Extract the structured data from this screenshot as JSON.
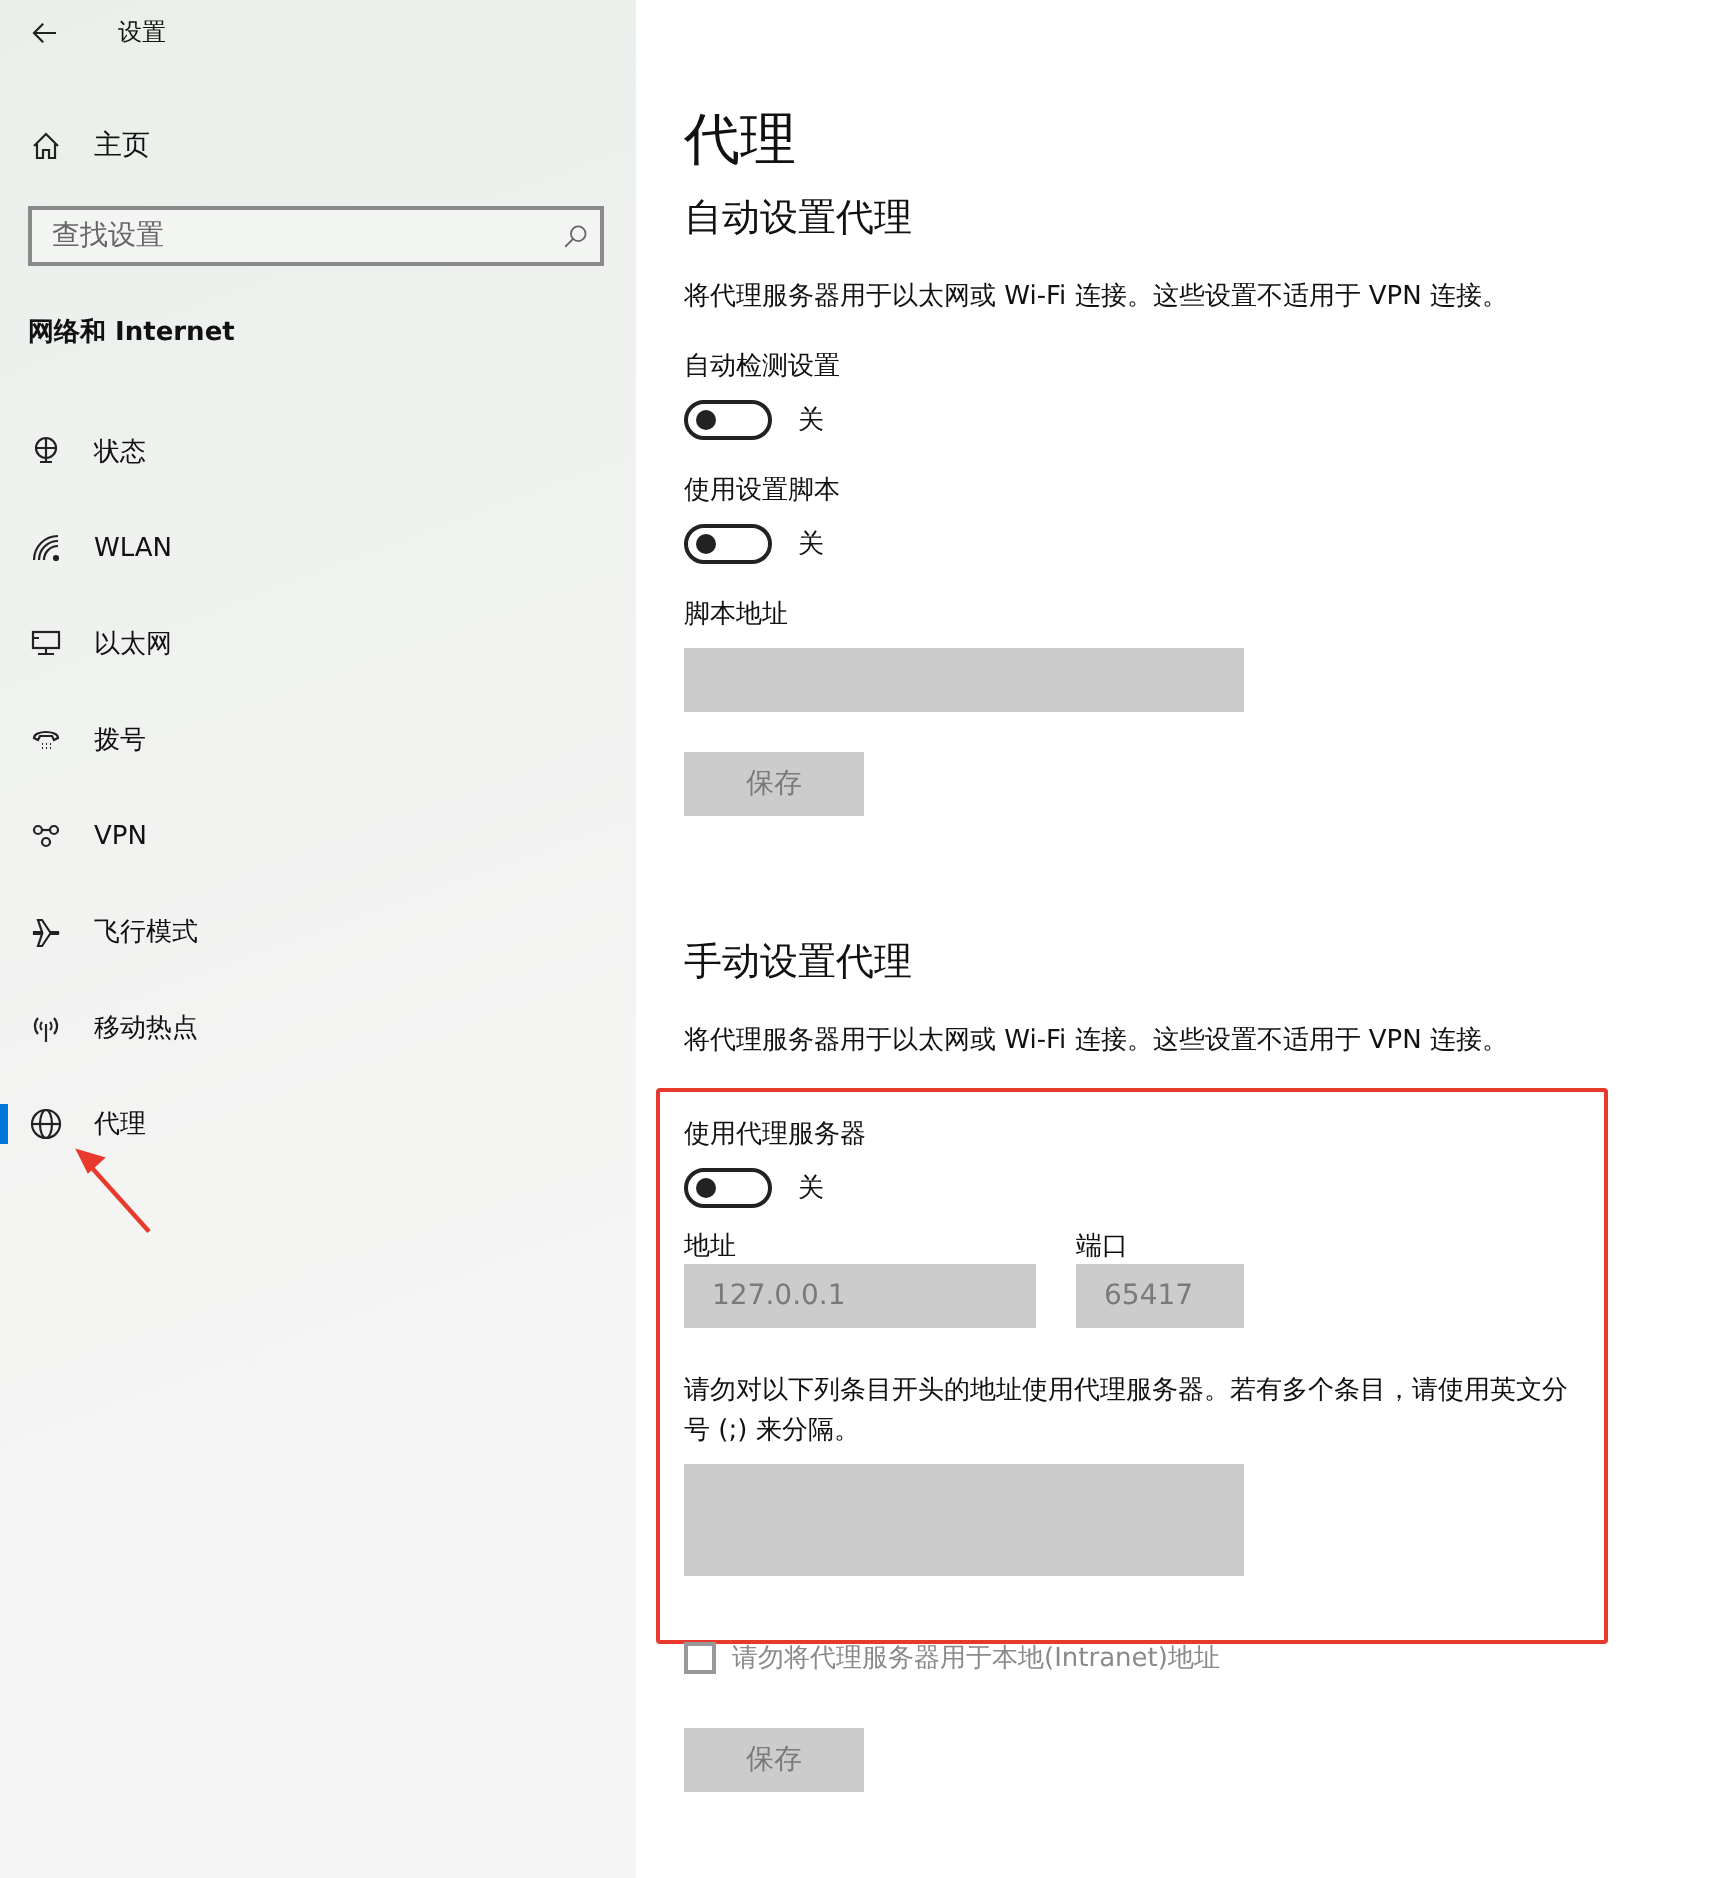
{
  "window": {
    "title": "设置"
  },
  "sidebar": {
    "home": "主页",
    "search": {
      "placeholder": "查找设置"
    },
    "section": "网络和 Internet",
    "pointer_arrow": true,
    "items": [
      {
        "label": "状态",
        "selected": false
      },
      {
        "label": "WLAN",
        "selected": false
      },
      {
        "label": "以太网",
        "selected": false
      },
      {
        "label": "拨号",
        "selected": false
      },
      {
        "label": "VPN",
        "selected": false
      },
      {
        "label": "飞行模式",
        "selected": false
      },
      {
        "label": "移动热点",
        "selected": false
      },
      {
        "label": "代理",
        "selected": true
      }
    ]
  },
  "page": {
    "title": "代理",
    "automatic": {
      "heading": "自动设置代理",
      "description": "将代理服务器用于以太网或 Wi-Fi 连接。这些设置不适用于 VPN 连接。",
      "toggles": [
        {
          "label": "自动检测设置",
          "on": false,
          "state_text": "关"
        },
        {
          "label": "使用设置脚本",
          "on": false,
          "state_text": "关"
        }
      ],
      "script_address": {
        "label": "脚本地址",
        "disabled": true
      },
      "save": {
        "label": "保存",
        "disabled": true
      }
    },
    "manual": {
      "heading": "手动设置代理",
      "description": "将代理服务器用于以太网或 Wi-Fi 连接。这些设置不适用于 VPN 连接。",
      "highlighted": true,
      "toggle": {
        "label": "使用代理服务器",
        "on": false,
        "state_text": "关"
      },
      "address": {
        "label": "地址",
        "value": "127.0.0.1",
        "disabled": true
      },
      "port": {
        "label": "端口",
        "value": "65417",
        "disabled": true
      },
      "note": "请勿对以下列条目开头的地址使用代理服务器。若有多个条目，请使用英文分号 (;) 来分隔。",
      "exceptions": {
        "disabled": true
      },
      "local_checkbox": {
        "label": "请勿将代理服务器用于本地(Intranet)地址",
        "checked": false,
        "disabled": true
      },
      "save": {
        "label": "保存",
        "disabled": true
      }
    }
  }
}
